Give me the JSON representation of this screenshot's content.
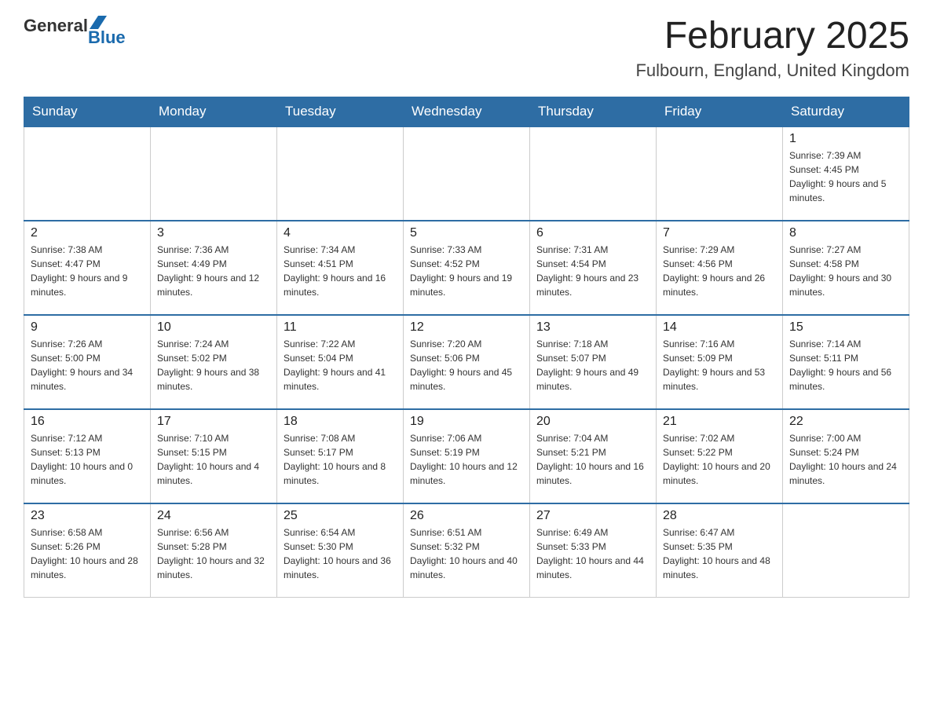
{
  "header": {
    "logo_general": "General",
    "logo_blue": "Blue",
    "title": "February 2025",
    "subtitle": "Fulbourn, England, United Kingdom"
  },
  "days_of_week": [
    "Sunday",
    "Monday",
    "Tuesday",
    "Wednesday",
    "Thursday",
    "Friday",
    "Saturday"
  ],
  "weeks": [
    {
      "days": [
        {
          "number": "",
          "info": ""
        },
        {
          "number": "",
          "info": ""
        },
        {
          "number": "",
          "info": ""
        },
        {
          "number": "",
          "info": ""
        },
        {
          "number": "",
          "info": ""
        },
        {
          "number": "",
          "info": ""
        },
        {
          "number": "1",
          "info": "Sunrise: 7:39 AM\nSunset: 4:45 PM\nDaylight: 9 hours and 5 minutes."
        }
      ]
    },
    {
      "days": [
        {
          "number": "2",
          "info": "Sunrise: 7:38 AM\nSunset: 4:47 PM\nDaylight: 9 hours and 9 minutes."
        },
        {
          "number": "3",
          "info": "Sunrise: 7:36 AM\nSunset: 4:49 PM\nDaylight: 9 hours and 12 minutes."
        },
        {
          "number": "4",
          "info": "Sunrise: 7:34 AM\nSunset: 4:51 PM\nDaylight: 9 hours and 16 minutes."
        },
        {
          "number": "5",
          "info": "Sunrise: 7:33 AM\nSunset: 4:52 PM\nDaylight: 9 hours and 19 minutes."
        },
        {
          "number": "6",
          "info": "Sunrise: 7:31 AM\nSunset: 4:54 PM\nDaylight: 9 hours and 23 minutes."
        },
        {
          "number": "7",
          "info": "Sunrise: 7:29 AM\nSunset: 4:56 PM\nDaylight: 9 hours and 26 minutes."
        },
        {
          "number": "8",
          "info": "Sunrise: 7:27 AM\nSunset: 4:58 PM\nDaylight: 9 hours and 30 minutes."
        }
      ]
    },
    {
      "days": [
        {
          "number": "9",
          "info": "Sunrise: 7:26 AM\nSunset: 5:00 PM\nDaylight: 9 hours and 34 minutes."
        },
        {
          "number": "10",
          "info": "Sunrise: 7:24 AM\nSunset: 5:02 PM\nDaylight: 9 hours and 38 minutes."
        },
        {
          "number": "11",
          "info": "Sunrise: 7:22 AM\nSunset: 5:04 PM\nDaylight: 9 hours and 41 minutes."
        },
        {
          "number": "12",
          "info": "Sunrise: 7:20 AM\nSunset: 5:06 PM\nDaylight: 9 hours and 45 minutes."
        },
        {
          "number": "13",
          "info": "Sunrise: 7:18 AM\nSunset: 5:07 PM\nDaylight: 9 hours and 49 minutes."
        },
        {
          "number": "14",
          "info": "Sunrise: 7:16 AM\nSunset: 5:09 PM\nDaylight: 9 hours and 53 minutes."
        },
        {
          "number": "15",
          "info": "Sunrise: 7:14 AM\nSunset: 5:11 PM\nDaylight: 9 hours and 56 minutes."
        }
      ]
    },
    {
      "days": [
        {
          "number": "16",
          "info": "Sunrise: 7:12 AM\nSunset: 5:13 PM\nDaylight: 10 hours and 0 minutes."
        },
        {
          "number": "17",
          "info": "Sunrise: 7:10 AM\nSunset: 5:15 PM\nDaylight: 10 hours and 4 minutes."
        },
        {
          "number": "18",
          "info": "Sunrise: 7:08 AM\nSunset: 5:17 PM\nDaylight: 10 hours and 8 minutes."
        },
        {
          "number": "19",
          "info": "Sunrise: 7:06 AM\nSunset: 5:19 PM\nDaylight: 10 hours and 12 minutes."
        },
        {
          "number": "20",
          "info": "Sunrise: 7:04 AM\nSunset: 5:21 PM\nDaylight: 10 hours and 16 minutes."
        },
        {
          "number": "21",
          "info": "Sunrise: 7:02 AM\nSunset: 5:22 PM\nDaylight: 10 hours and 20 minutes."
        },
        {
          "number": "22",
          "info": "Sunrise: 7:00 AM\nSunset: 5:24 PM\nDaylight: 10 hours and 24 minutes."
        }
      ]
    },
    {
      "days": [
        {
          "number": "23",
          "info": "Sunrise: 6:58 AM\nSunset: 5:26 PM\nDaylight: 10 hours and 28 minutes."
        },
        {
          "number": "24",
          "info": "Sunrise: 6:56 AM\nSunset: 5:28 PM\nDaylight: 10 hours and 32 minutes."
        },
        {
          "number": "25",
          "info": "Sunrise: 6:54 AM\nSunset: 5:30 PM\nDaylight: 10 hours and 36 minutes."
        },
        {
          "number": "26",
          "info": "Sunrise: 6:51 AM\nSunset: 5:32 PM\nDaylight: 10 hours and 40 minutes."
        },
        {
          "number": "27",
          "info": "Sunrise: 6:49 AM\nSunset: 5:33 PM\nDaylight: 10 hours and 44 minutes."
        },
        {
          "number": "28",
          "info": "Sunrise: 6:47 AM\nSunset: 5:35 PM\nDaylight: 10 hours and 48 minutes."
        },
        {
          "number": "",
          "info": ""
        }
      ]
    }
  ]
}
